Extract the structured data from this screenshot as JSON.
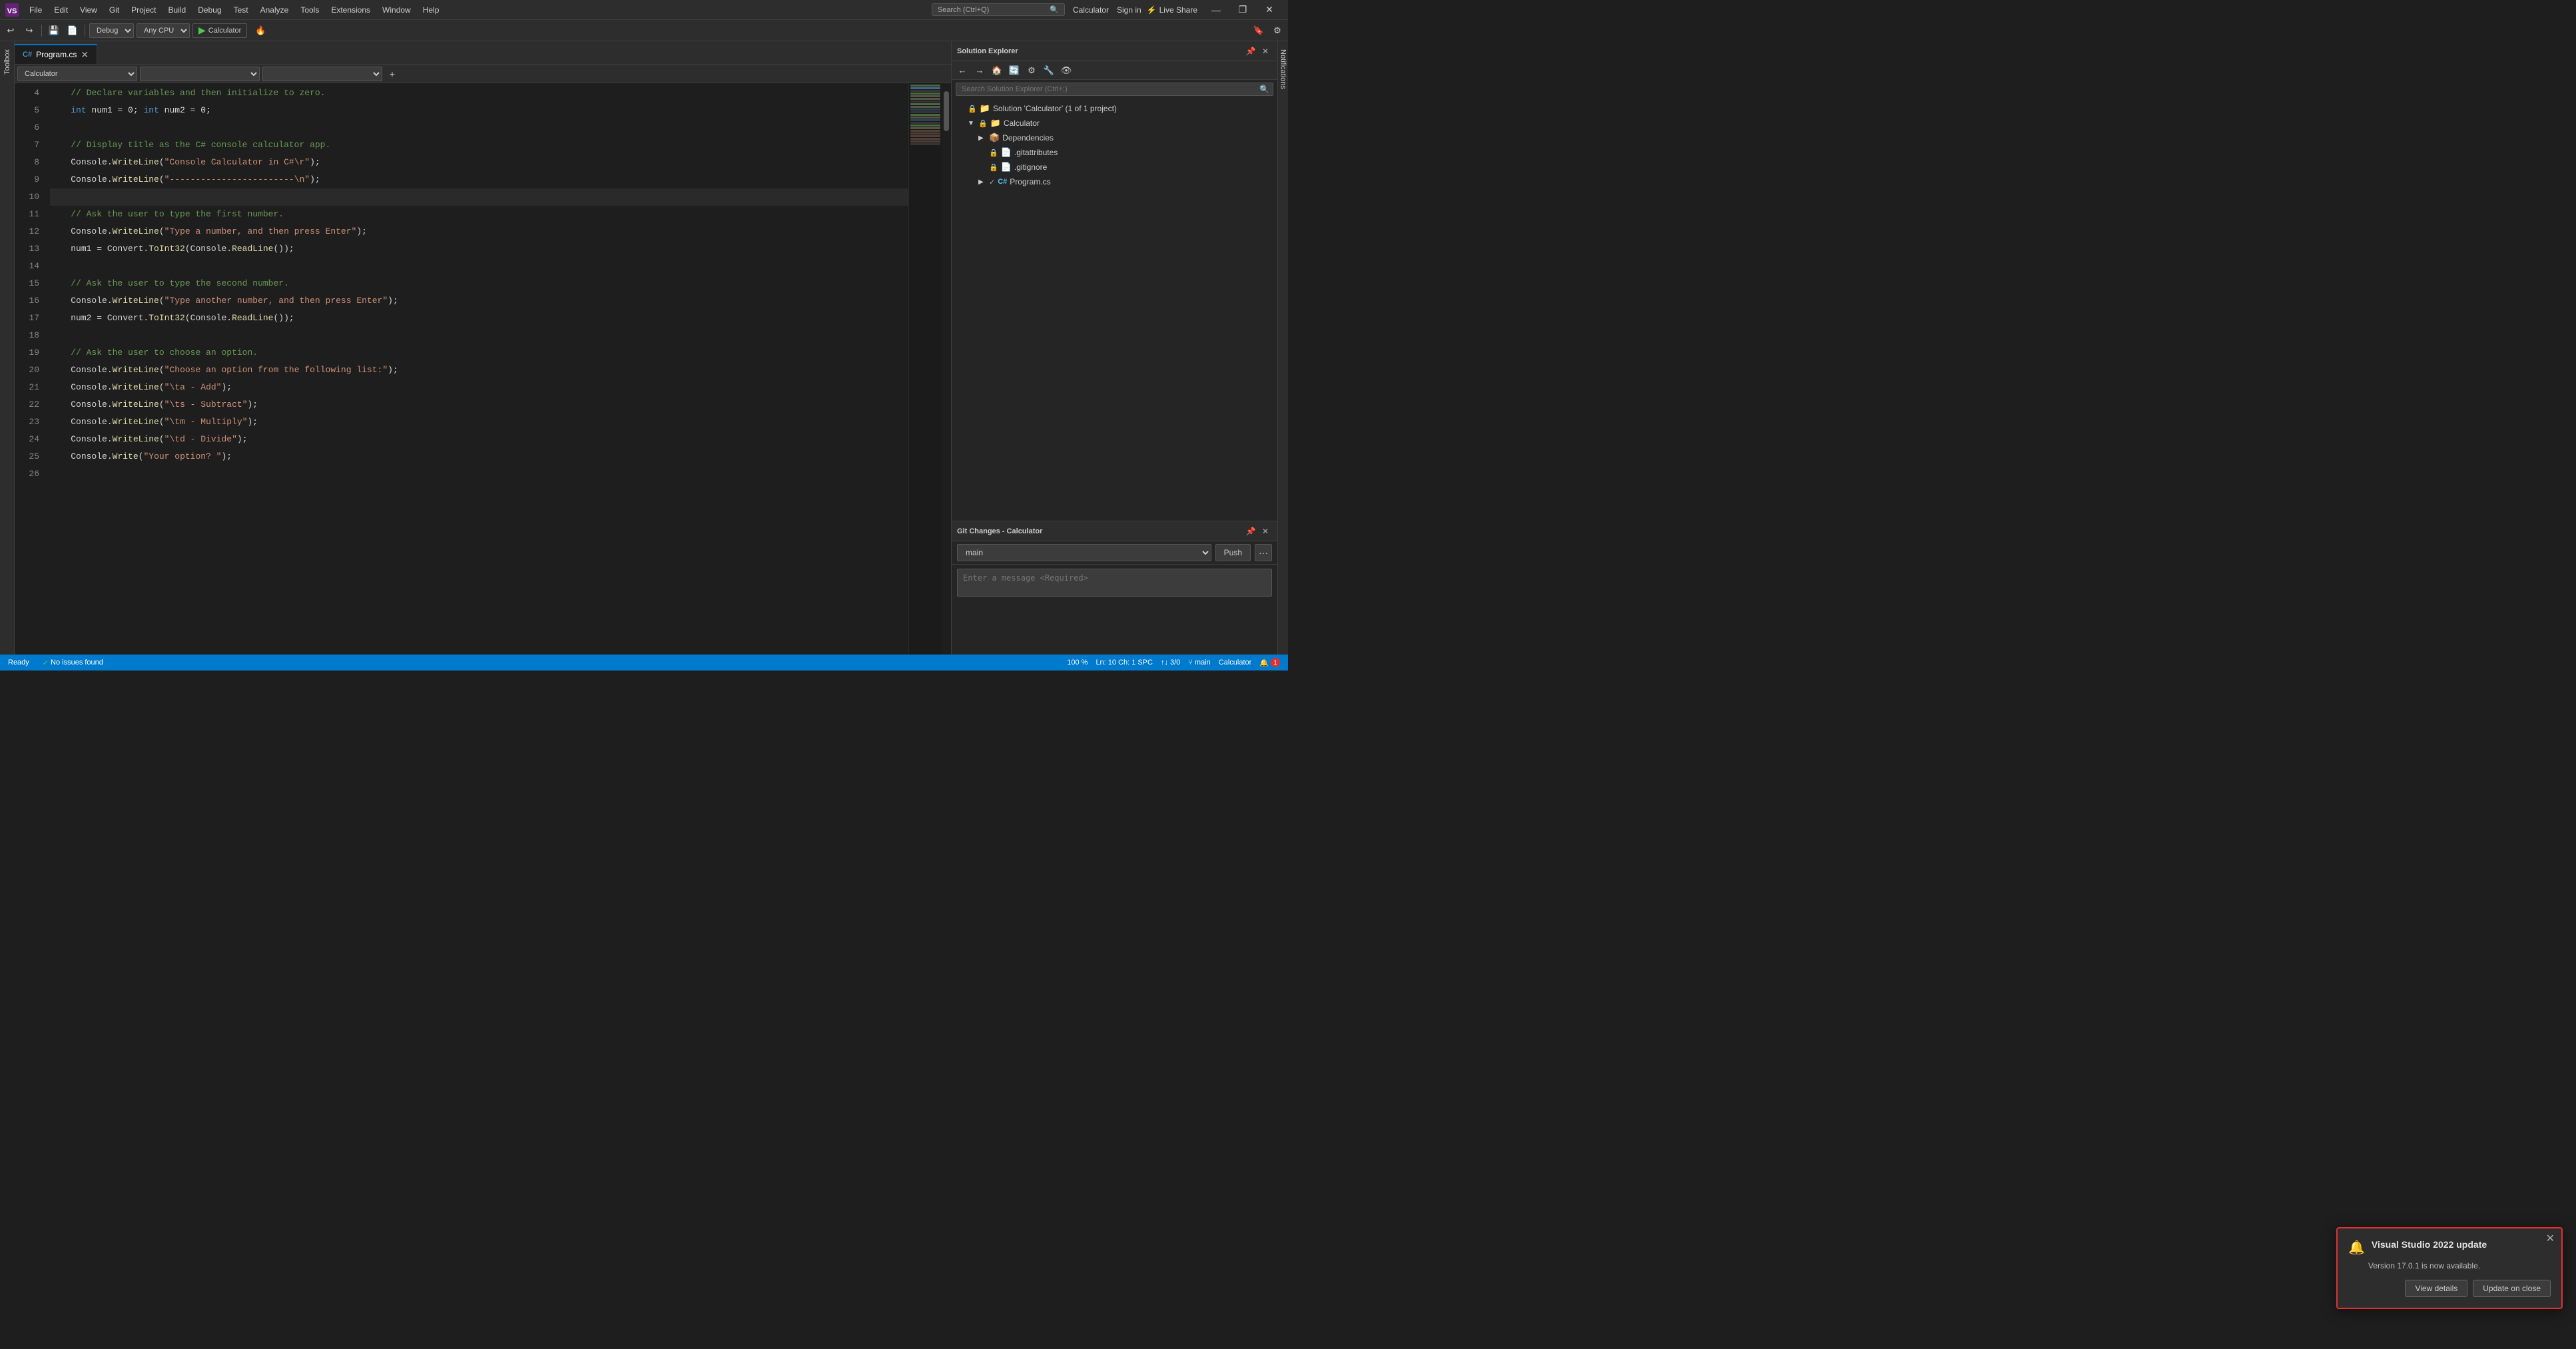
{
  "app": {
    "title": "Calculator",
    "sign_in": "Sign in"
  },
  "titlebar": {
    "logo": "VS",
    "menus": [
      "File",
      "Edit",
      "View",
      "Git",
      "Project",
      "Build",
      "Debug",
      "Test",
      "Analyze",
      "Tools",
      "Extensions",
      "Window",
      "Help"
    ],
    "search_placeholder": "Search (Ctrl+Q)",
    "live_share": "Live Share",
    "window_controls": [
      "—",
      "❐",
      "✕"
    ]
  },
  "toolbar": {
    "config": "Debug",
    "platform": "Any CPU",
    "run_label": "Calculator",
    "run_icon": "▶"
  },
  "editor": {
    "tab_label": "Program.cs",
    "dropdowns": [
      "Calculator",
      "",
      ""
    ],
    "lines": [
      {
        "num": 4,
        "content": "    <comment>// Declare variables and then initialize to zero.</comment>"
      },
      {
        "num": 5,
        "content": "    <kw>int</kw> num1 = 0; <kw>int</kw> num2 = 0;"
      },
      {
        "num": 6,
        "content": ""
      },
      {
        "num": 7,
        "content": "    <comment>// Display title as the C# console calculator app.</comment>"
      },
      {
        "num": 8,
        "content": "    Console.<method>WriteLine</method>(<str>\"Console Calculator in C#\\r\"</str>);"
      },
      {
        "num": 9,
        "content": "    Console.<method>WriteLine</method>(<str>\"------------------------\\n\"</str>);"
      },
      {
        "num": 10,
        "content": ""
      },
      {
        "num": 11,
        "content": "    <comment>// Ask the user to type the first number.</comment>"
      },
      {
        "num": 12,
        "content": "    Console.<method>WriteLine</method>(<str>\"Type a number, and then press Enter\"</str>);"
      },
      {
        "num": 13,
        "content": "    num1 = Convert.<method>ToInt32</method>(Console.<method>ReadLine</method>());"
      },
      {
        "num": 14,
        "content": ""
      },
      {
        "num": 15,
        "content": "    <comment>// Ask the user to type the second number.</comment>"
      },
      {
        "num": 16,
        "content": "    Console.<method>WriteLine</method>(<str>\"Type another number, and then press Enter\"</str>);"
      },
      {
        "num": 17,
        "content": "    num2 = Convert.<method>ToInt32</method>(Console.<method>ReadLine</method>());"
      },
      {
        "num": 18,
        "content": ""
      },
      {
        "num": 19,
        "content": "    <comment>// Ask the user to choose an option.</comment>"
      },
      {
        "num": 20,
        "content": "    Console.<method>WriteLine</method>(<str>\"Choose an option from the following list:\"</str>);"
      },
      {
        "num": 21,
        "content": "    Console.<method>WriteLine</method>(<str>\"\\ta - Add\"</str>);"
      },
      {
        "num": 22,
        "content": "    Console.<method>WriteLine</method>(<str>\"\\ts - Subtract\"</str>);"
      },
      {
        "num": 23,
        "content": "    Console.<method>WriteLine</method>(<str>\"\\tm - Multiply\"</str>);"
      },
      {
        "num": 24,
        "content": "    Console.<method>WriteLine</method>(<str>\"\\td - Divide\"</str>);"
      },
      {
        "num": 25,
        "content": "    Console.<method>Write</method>(<str>\"Your option? \"</str>);"
      },
      {
        "num": 26,
        "content": ""
      }
    ],
    "cursor": {
      "line": 10,
      "col": 1
    }
  },
  "solution_explorer": {
    "title": "Solution Explorer",
    "search_placeholder": "Search Solution Explorer (Ctrl+;)",
    "tree": [
      {
        "level": 1,
        "icon": "📁",
        "label": "Solution 'Calculator' (1 of 1 project)",
        "hasArrow": false,
        "locked": false
      },
      {
        "level": 2,
        "icon": "📁",
        "label": "Calculator",
        "hasArrow": true,
        "locked": true
      },
      {
        "level": 3,
        "icon": "📦",
        "label": "Dependencies",
        "hasArrow": true,
        "locked": false
      },
      {
        "level": 3,
        "icon": "📄",
        "label": ".gitattributes",
        "hasArrow": false,
        "locked": true
      },
      {
        "level": 3,
        "icon": "📄",
        "label": ".gitignore",
        "hasArrow": false,
        "locked": true
      },
      {
        "level": 3,
        "icon": "📄",
        "label": "Program.cs",
        "hasArrow": true,
        "locked": false
      }
    ]
  },
  "git_changes": {
    "title": "Git Changes - Calculator",
    "branch": "main",
    "push_label": "Push",
    "more_icon": "···",
    "message_placeholder": "Enter a message <Required>"
  },
  "status_bar": {
    "ready": "Ready",
    "issues": "No issues found",
    "ln": "Ln: 10",
    "ch": "Ch: 1",
    "spc": "SPC",
    "zoom": "100 %",
    "branch": "main",
    "project": "Calculator",
    "changes": "↑↓ 3/0"
  },
  "notification": {
    "title": "Visual Studio 2022 update",
    "body": "Version 17.0.1 is now available.",
    "view_details": "View details",
    "update_on_close": "Update on close",
    "close_icon": "✕"
  }
}
